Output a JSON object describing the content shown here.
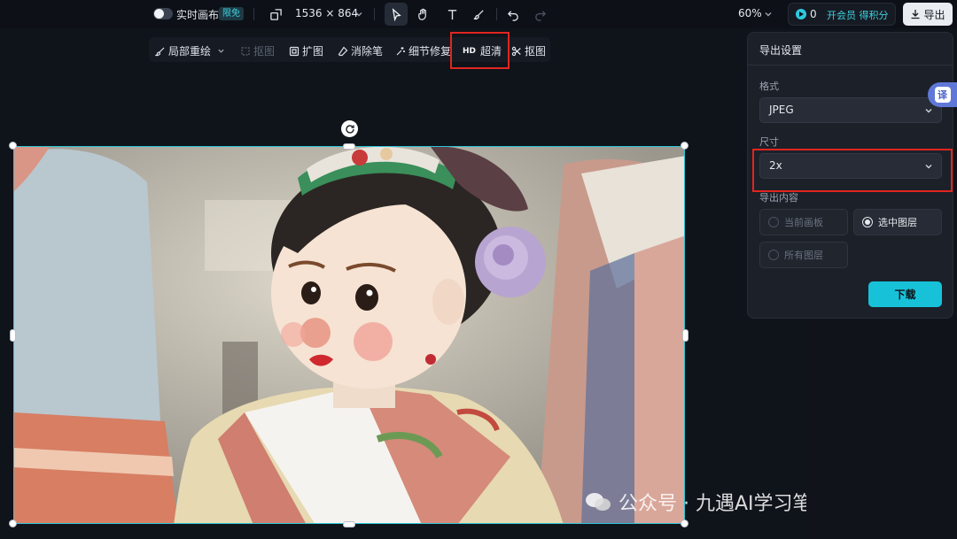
{
  "topbar": {
    "realtime_label": "实时画布",
    "realtime_badge": "限免",
    "canvas_size": "1536 × 864",
    "zoom": "60%",
    "points_count": "0",
    "member_link": "开会员 得积分",
    "export_label": "导出"
  },
  "subtoolbar": {
    "items": [
      {
        "label": "局部重绘",
        "icon": "brush-icon"
      },
      {
        "label": "抠图",
        "icon": "crop-icon",
        "disabled": true
      },
      {
        "label": "扩图",
        "icon": "expand-icon"
      },
      {
        "label": "消除笔",
        "icon": "eraser-icon"
      },
      {
        "label": "细节修复",
        "icon": "sparkle-icon"
      },
      {
        "label": "超清",
        "tag": "HD"
      },
      {
        "label": "抠图",
        "icon": "cutout-icon"
      }
    ]
  },
  "export_panel": {
    "title": "导出设置",
    "format_label": "格式",
    "format_value": "JPEG",
    "size_label": "尺寸",
    "size_value": "2x",
    "content_label": "导出内容",
    "options": [
      {
        "label": "当前画板",
        "checked": false
      },
      {
        "label": "选中图层",
        "checked": true
      },
      {
        "label": "所有图层",
        "checked": false
      }
    ],
    "download_label": "下载"
  },
  "translate_label": "译",
  "watermark": "公众号 · 九遇AI学习笔记",
  "colors": {
    "accent": "#17c2d9",
    "highlight": "#e0261f",
    "selection": "#2bc4d6"
  }
}
